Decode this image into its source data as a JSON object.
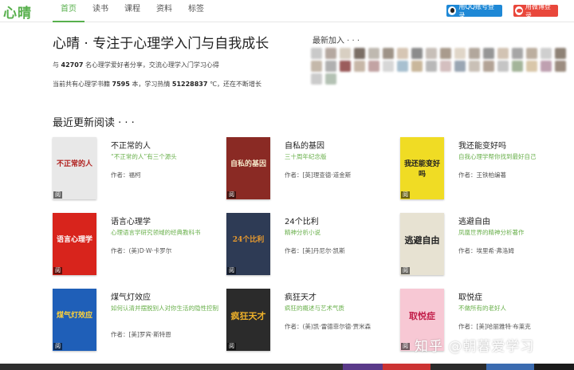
{
  "brand": {
    "logo": "心晴"
  },
  "nav": [
    {
      "label": "首页",
      "active": true
    },
    {
      "label": "读书",
      "active": false
    },
    {
      "label": "课程",
      "active": false
    },
    {
      "label": "资料",
      "active": false
    },
    {
      "label": "标签",
      "active": false
    }
  ],
  "login": {
    "qq": "用QQ账号登录",
    "weibo": "用微博登录"
  },
  "hero": {
    "title": "心晴 · 专注于心理学入门与自我成长",
    "line1_pre": "与",
    "line1_count": "42707",
    "line1_post": "名心理学爱好者分享，交流心理学入门学习心得",
    "line2_pre": "当前共有心理学书籍",
    "line2_books": "7595",
    "line2_mid": "本，学习热情",
    "line2_heat": "51228837",
    "line2_post": "℃，还在不断增长"
  },
  "latest": {
    "label": "最新加入 · · ·"
  },
  "section": {
    "title": "最近更新阅读 · · ·"
  },
  "books": [
    {
      "title": "不正常的人",
      "subtitle": "“不正常的人”有三个源头",
      "author": "作者：福柯",
      "cover_text": "不正常的人",
      "cover_bg": "#e8e8e8",
      "cover_fg": "#b0201e",
      "badge": "阅"
    },
    {
      "title": "自私的基因",
      "subtitle": "三十周年纪念版",
      "author": "作者：[英]理查德·道金斯",
      "cover_text": "自私的基因",
      "cover_bg": "#8a2a24",
      "cover_fg": "#f3e6c8",
      "badge": "阅"
    },
    {
      "title": "我还能变好吗",
      "subtitle": "自我心理学帮你找到最好自己",
      "author": "作者：王铁柏编著",
      "cover_text": "我还能变好吗",
      "cover_bg": "#f0dc24",
      "cover_fg": "#222222",
      "badge": "阅"
    },
    {
      "title": "语言心理学",
      "subtitle": "心理语言学研究领域的经典教科书",
      "author": "作者：(美)D·W·卡罗尔",
      "cover_text": "语言心理学",
      "cover_bg": "#d8241c",
      "cover_fg": "#ffffff",
      "badge": "阅"
    },
    {
      "title": "24个比利",
      "subtitle": "精神分析小说",
      "author": "作者：[美]丹尼尔·凯斯",
      "cover_text": "24个比利",
      "cover_bg": "#2e3b55",
      "cover_fg": "#e89a2e",
      "badge": "阅"
    },
    {
      "title": "逃避自由",
      "subtitle": "凤凰世界的精神分析著作",
      "author": "作者：埃里希·弗洛姆",
      "cover_text": "逃避自由",
      "cover_bg": "#e7e2d2",
      "cover_fg": "#222222",
      "badge": "阅"
    },
    {
      "title": "煤气灯效应",
      "subtitle": "如何认清并摆脱别人对你生活的隐性控制",
      "author": "作者：[美]罗宾·斯特恩",
      "cover_text": "煤气灯效应",
      "cover_bg": "#1f5fb8",
      "cover_fg": "#ffd23a",
      "badge": "阅"
    },
    {
      "title": "疯狂天才",
      "subtitle": "疯狂的概述与艺术气质",
      "author": "作者：(美)凯·雷德菲尔德·贾米森",
      "cover_text": "疯狂天才",
      "cover_bg": "#2b2b2b",
      "cover_fg": "#f0b22a",
      "badge": "阅"
    },
    {
      "title": "取悦症",
      "subtitle": "不做所有的老好人",
      "author": "作者：[美]哈丽雅特·布莱克",
      "cover_text": "取悦症",
      "cover_bg": "#f7c8d4",
      "cover_fg": "#c21f4a",
      "badge": "阅"
    }
  ],
  "watermark": "知乎 @朝暮爱学习",
  "avatar_colors": [
    "#c9c9c9",
    "#b5a8a0",
    "#d8cfc2",
    "#7b6f66",
    "#bfb9b0",
    "#9e9387",
    "#d6c6b4",
    "#8c8c8c",
    "#c7bfb8",
    "#a99b8d",
    "#e0d6c8",
    "#b2a79c",
    "#969696",
    "#d2c3b3",
    "#a6a6a6",
    "#bcae9f",
    "#cfcfcf",
    "#8e8276",
    "#c4b8aa",
    "#b0b0b0",
    "#9b5c5c",
    "#c7b7a7",
    "#c2a3a3",
    "#d7d7d7",
    "#a8c0d0",
    "#c9b79b",
    "#b8b8b8",
    "#d4bfbf",
    "#9aa6b3",
    "#c9c0b6",
    "#b3a396",
    "#c5c5c5",
    "#a4b59a",
    "#d9c7a9",
    "#bfa0b0",
    "#9c8d80",
    "#cbcbcb",
    "#b4c2b4"
  ],
  "bottom_strip": [
    "#2e2e2e",
    "#5a3a8a",
    "#c33",
    "#2b2b2b",
    "#3b6bb0",
    "#1b1b1b"
  ]
}
